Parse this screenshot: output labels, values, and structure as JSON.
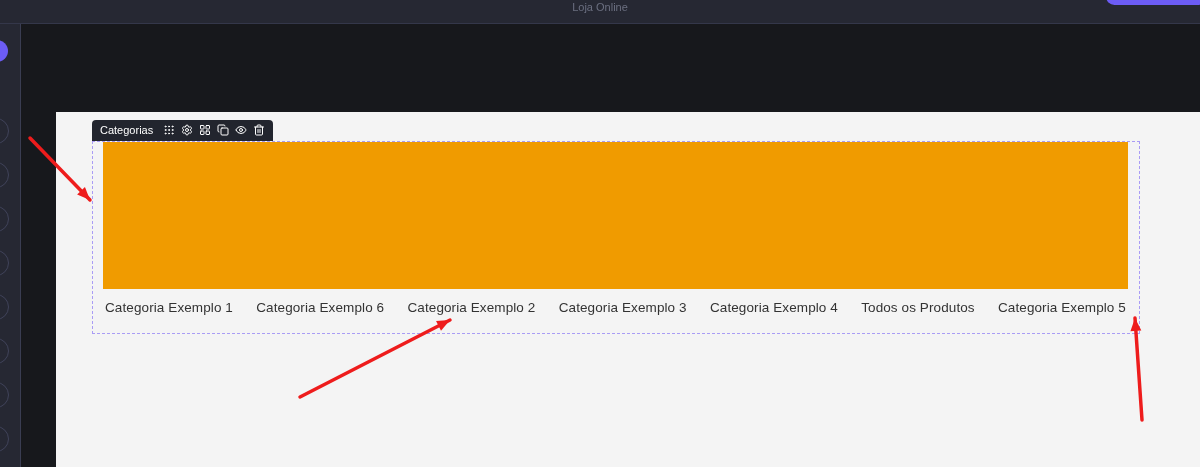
{
  "window": {
    "title": "Loja Online"
  },
  "block_toolbar": {
    "label": "Categorias"
  },
  "categories": [
    "Categoria Exemplo 1",
    "Categoria Exemplo 6",
    "Categoria Exemplo 2",
    "Categoria Exemplo 3",
    "Categoria Exemplo 4",
    "Todos os Produtos",
    "Categoria Exemplo 5"
  ]
}
